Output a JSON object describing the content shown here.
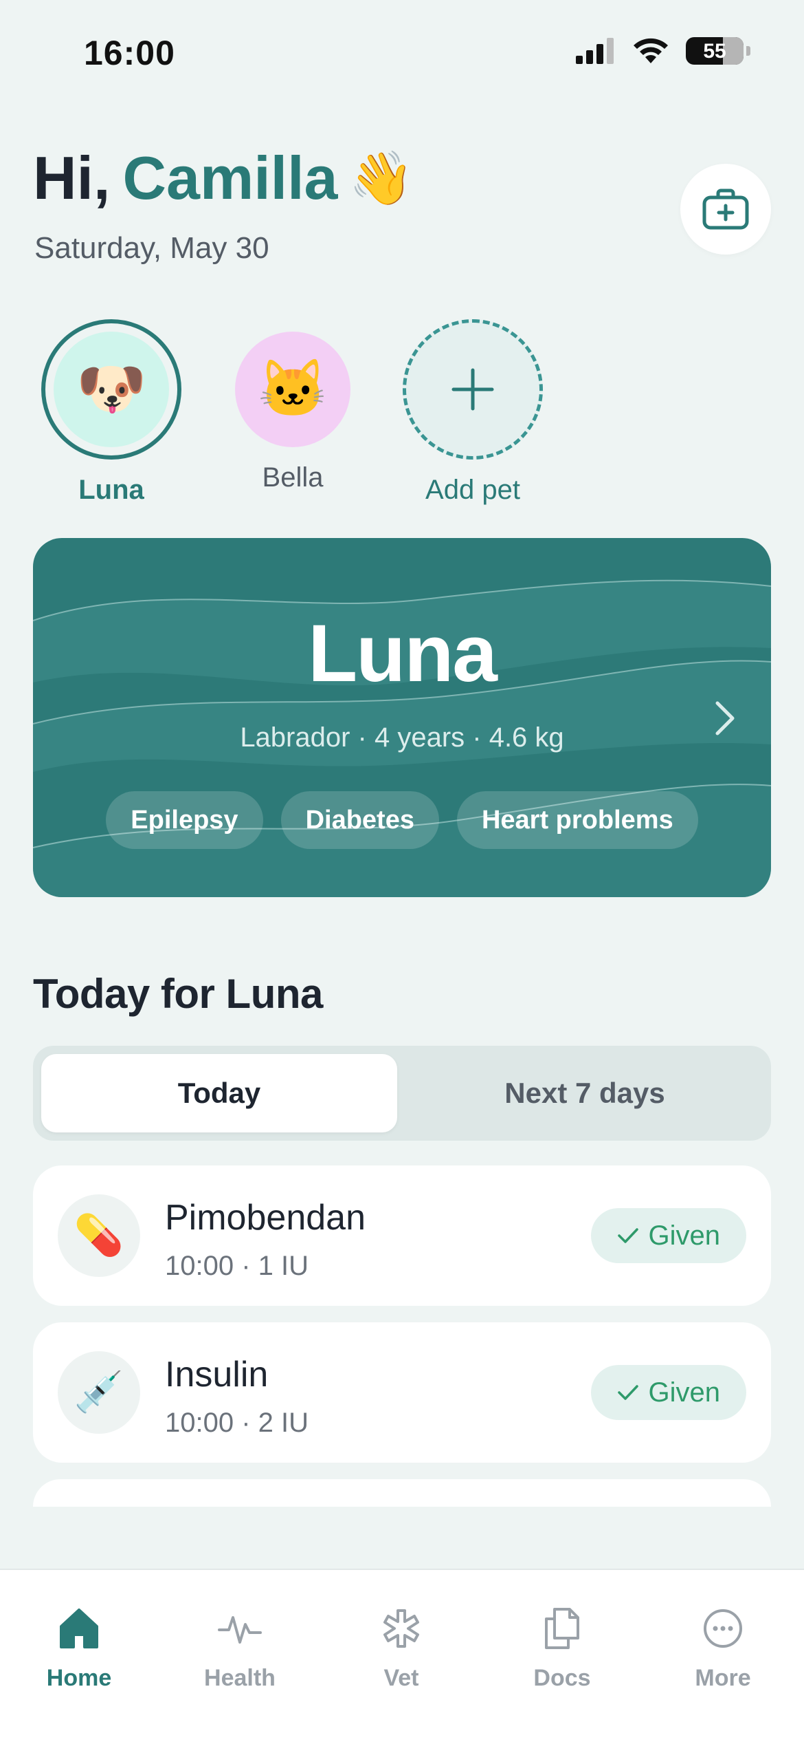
{
  "status_bar": {
    "time": "16:00",
    "battery": "55"
  },
  "header": {
    "greeting_prefix": "Hi,",
    "user_name": "Camilla",
    "wave_emoji": "👋",
    "date": "Saturday, May 30",
    "first_aid_icon": "first-aid-kit-icon"
  },
  "pets": [
    {
      "name": "Luna",
      "emoji": "🐶",
      "bg": "#CFF5EC",
      "active": true
    },
    {
      "name": "Bella",
      "emoji": "🐱",
      "bg": "#F3CFF5",
      "active": false
    }
  ],
  "add_pet": {
    "label": "Add pet"
  },
  "pet_card": {
    "name": "Luna",
    "subtitle": "Labrador · 4 years · 4.6 kg",
    "tags": [
      "Epilepsy",
      "Diabetes",
      "Heart problems"
    ]
  },
  "today": {
    "title": "Today for Luna",
    "tabs": [
      "Today",
      "Next 7 days"
    ],
    "selected_tab": "Today",
    "medications": [
      {
        "name": "Pimobendan",
        "detail": "10:00 · 1 IU",
        "emoji": "💊",
        "status": "Given"
      },
      {
        "name": "Insulin",
        "detail": "10:00 · 2 IU",
        "emoji": "💉",
        "status": "Given"
      }
    ]
  },
  "nav": {
    "items": [
      {
        "label": "Home",
        "icon": "home-icon",
        "active": true
      },
      {
        "label": "Health",
        "icon": "pulse-icon",
        "active": false
      },
      {
        "label": "Vet",
        "icon": "medical-star-icon",
        "active": false
      },
      {
        "label": "Docs",
        "icon": "documents-icon",
        "active": false
      },
      {
        "label": "More",
        "icon": "more-icon",
        "active": false
      }
    ]
  },
  "colors": {
    "brand": "#2A7A77",
    "background": "#EEF4F3",
    "given_text": "#2E9A6A",
    "given_bg": "#E3F1EE"
  }
}
